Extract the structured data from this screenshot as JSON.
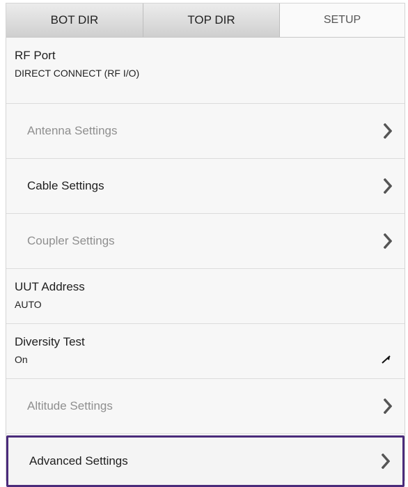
{
  "tabs": [
    {
      "label": "BOT DIR"
    },
    {
      "label": "TOP DIR"
    },
    {
      "label": "SETUP"
    }
  ],
  "setup": {
    "rf_port": {
      "title": "RF Port",
      "value": "DIRECT CONNECT (RF I/O)"
    },
    "antenna": {
      "label": "Antenna Settings"
    },
    "cable": {
      "label": "Cable Settings"
    },
    "coupler": {
      "label": "Coupler Settings"
    },
    "uut_address": {
      "title": "UUT Address",
      "value": "AUTO"
    },
    "diversity": {
      "title": "Diversity Test",
      "value": "On"
    },
    "altitude": {
      "label": "Altitude Settings"
    },
    "advanced": {
      "label": "Advanced Settings"
    }
  },
  "icons": {
    "chevron": "chevron-right-icon",
    "cursor": "cursor-arrow-icon"
  },
  "colors": {
    "selected_border": "#4a2b7a",
    "disabled_text": "#8f8f8f",
    "tab_active_bg": "#fafafa"
  }
}
